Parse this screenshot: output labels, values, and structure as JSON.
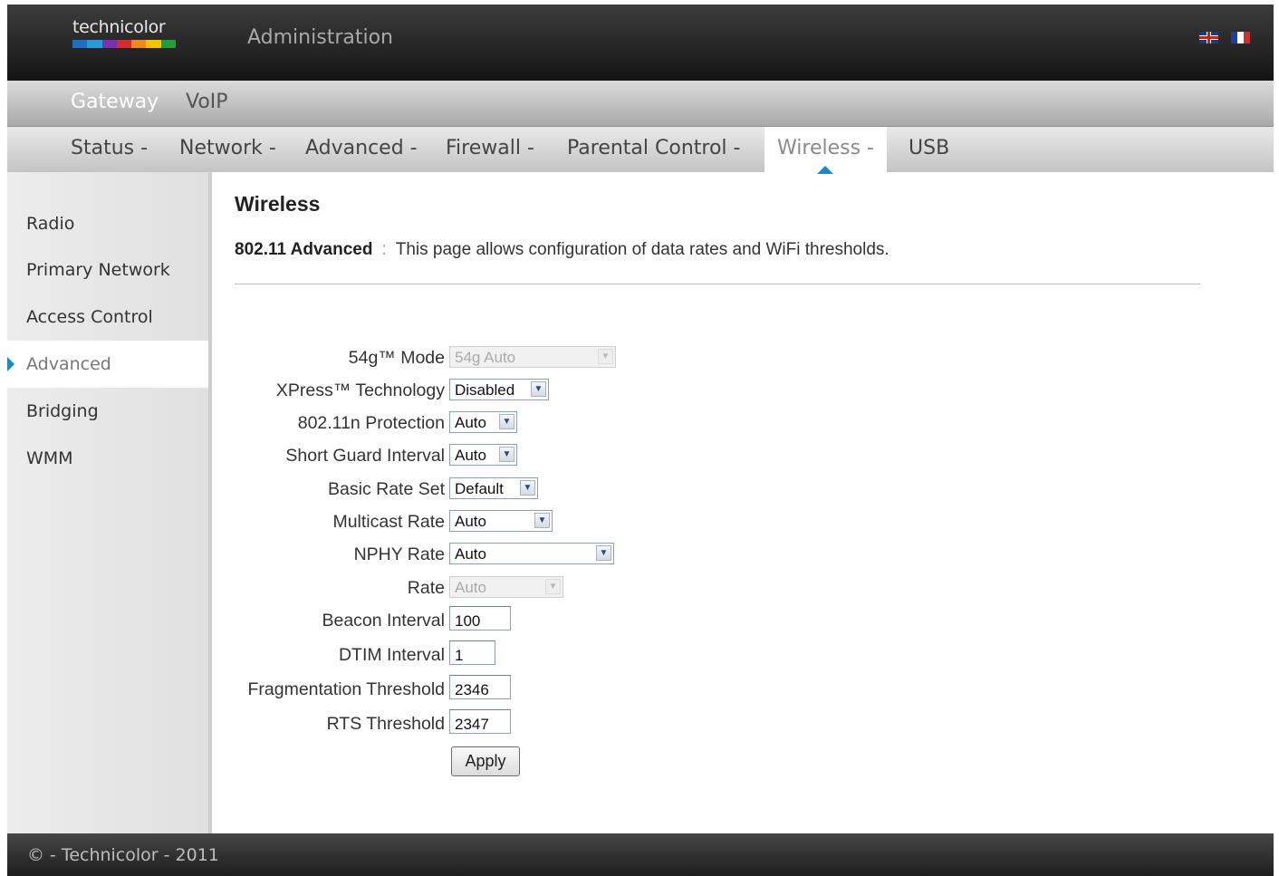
{
  "header": {
    "logo_text": "technicolor",
    "logo_colors": [
      "#1b6fc4",
      "#2a9ad8",
      "#7b2fb0",
      "#d42b2b",
      "#f08a1c",
      "#f6c200",
      "#1e9f3a"
    ],
    "title": "Administration",
    "languages": [
      "en-icon",
      "fr-icon"
    ]
  },
  "product_nav": {
    "gateway": "Gateway",
    "voip": "VoIP"
  },
  "section_nav": {
    "tabs": [
      {
        "label": "Status -"
      },
      {
        "label": "Network -"
      },
      {
        "label": "Advanced -"
      },
      {
        "label": "Firewall -"
      },
      {
        "label": "Parental Control -"
      },
      {
        "label": "Wireless -",
        "active": true
      },
      {
        "label": "USB"
      }
    ]
  },
  "sidebar": {
    "items": [
      {
        "label": "Radio"
      },
      {
        "label": "Primary Network"
      },
      {
        "label": "Access Control"
      },
      {
        "label": "Advanced",
        "active": true
      },
      {
        "label": "Bridging"
      },
      {
        "label": "WMM"
      }
    ]
  },
  "main": {
    "title": "Wireless",
    "desc_bold": "802.11 Advanced",
    "desc_sep": ":",
    "desc_text": "This page allows configuration of data rates and WiFi thresholds.",
    "fields": [
      {
        "label": "54g™ Mode",
        "value": "54g Auto",
        "type": "select",
        "disabled": true
      },
      {
        "label": "XPress™ Technology",
        "value": "Disabled",
        "type": "select"
      },
      {
        "label": "802.11n Protection",
        "value": "Auto",
        "type": "select"
      },
      {
        "label": "Short Guard Interval",
        "value": "Auto",
        "type": "select"
      },
      {
        "label": "Basic Rate Set",
        "value": "Default",
        "type": "select"
      },
      {
        "label": "Multicast Rate",
        "value": "Auto",
        "type": "select"
      },
      {
        "label": "NPHY Rate",
        "value": "Auto",
        "type": "select"
      },
      {
        "label": "Rate",
        "value": "Auto",
        "type": "select",
        "disabled": true
      },
      {
        "label": "Beacon Interval",
        "value": "100",
        "type": "text"
      },
      {
        "label": "DTIM Interval",
        "value": "1",
        "type": "text"
      },
      {
        "label": "Fragmentation Threshold",
        "value": "2346",
        "type": "text"
      },
      {
        "label": "RTS Threshold",
        "value": "2347",
        "type": "text"
      }
    ],
    "apply_label": "Apply"
  },
  "footer": {
    "copyright": "© - Technicolor - 2011"
  }
}
